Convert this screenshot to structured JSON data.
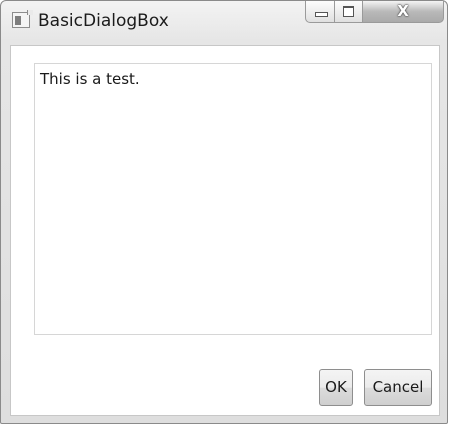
{
  "window": {
    "title": "BasicDialogBox",
    "caption_buttons": [
      {
        "name": "minimize",
        "icon": "minimize-icon"
      },
      {
        "name": "maximize",
        "icon": "maximize-icon"
      },
      {
        "name": "close",
        "icon": "close-icon",
        "glyph": "X"
      }
    ]
  },
  "textbox": {
    "value": "This is a test."
  },
  "buttons": {
    "ok_label": "OK",
    "cancel_label": "Cancel"
  }
}
